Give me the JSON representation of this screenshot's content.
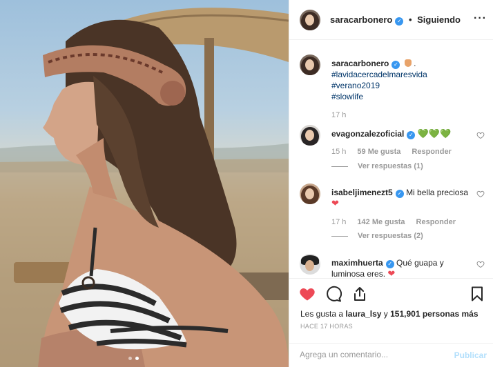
{
  "header": {
    "username": "saracarbonero",
    "separator": "•",
    "follow_status": "Siguiendo",
    "more_label": "···"
  },
  "caption": {
    "username": "saracarbonero",
    "suffix": ".",
    "hashtags": [
      "#lavidacercadelmaresvida",
      "#verano2019",
      "#slowlife"
    ],
    "time": "17 h"
  },
  "comments": [
    {
      "username": "evagonzalezoficial",
      "text": "💚💚💚",
      "time": "15 h",
      "likes": "59 Me gusta",
      "reply_label": "Responder",
      "replies": "Ver respuestas (1)"
    },
    {
      "username": "isabeljimenezt5",
      "text": "Mi bella preciosa",
      "emoji": "❤",
      "time": "17 h",
      "likes": "142 Me gusta",
      "reply_label": "Responder",
      "replies": "Ver respuestas (2)"
    },
    {
      "username": "maximhuerta",
      "text": "Qué guapa y luminosa eres.",
      "emoji": "❤"
    }
  ],
  "footer": {
    "likes_prefix": "Les gusta a ",
    "likes_user": "laura_lsy",
    "likes_middle": " y ",
    "likes_count": "151,901 personas más",
    "timestamp": "HACE 17 HORAS",
    "comment_placeholder": "Agrega un comentario...",
    "post_label": "Publicar"
  },
  "icons": {
    "like": "heart-icon",
    "comment": "comment-icon",
    "share": "share-icon",
    "save": "bookmark-icon"
  },
  "colors": {
    "verified": "#3897f0",
    "liked": "#ed4956",
    "hashtag": "#003569",
    "post_disabled": "#b2dffc"
  }
}
